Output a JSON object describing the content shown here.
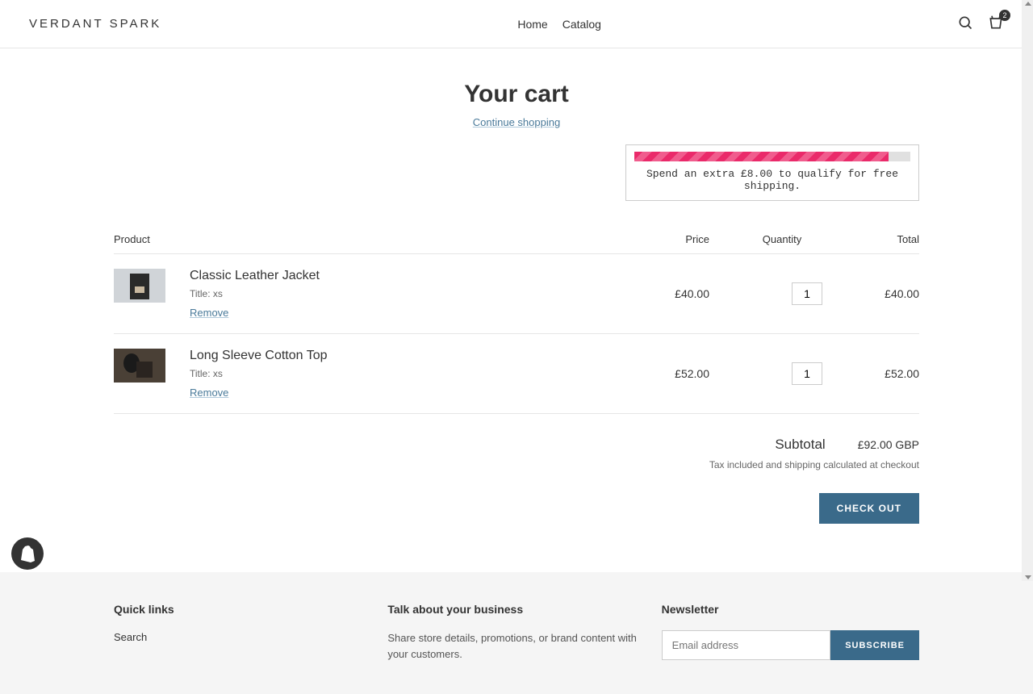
{
  "header": {
    "brand": "VERDANT SPARK",
    "nav": {
      "home": "Home",
      "catalog": "Catalog"
    },
    "cart_count": "2"
  },
  "page": {
    "title": "Your cart",
    "continue": "Continue shopping"
  },
  "shipping": {
    "message": "Spend an extra £8.00 to qualify for free shipping.",
    "progress_pct": 92
  },
  "table": {
    "headers": {
      "product": "Product",
      "price": "Price",
      "quantity": "Quantity",
      "total": "Total"
    }
  },
  "items": [
    {
      "name": "Classic Leather Jacket",
      "variant": "Title: xs",
      "remove": "Remove",
      "price": "£40.00",
      "qty": "1",
      "total": "£40.00"
    },
    {
      "name": "Long Sleeve Cotton Top",
      "variant": "Title: xs",
      "remove": "Remove",
      "price": "£52.00",
      "qty": "1",
      "total": "£52.00"
    }
  ],
  "summary": {
    "subtotal_label": "Subtotal",
    "subtotal_value": "£92.00 GBP",
    "tax": "Tax included and shipping calculated at checkout",
    "checkout": "CHECK OUT"
  },
  "footer": {
    "quick_title": "Quick links",
    "search": "Search",
    "talk_title": "Talk about your business",
    "talk_body": "Share store details, promotions, or brand content with your customers.",
    "news_title": "Newsletter",
    "email_placeholder": "Email address",
    "subscribe": "SUBSCRIBE"
  }
}
